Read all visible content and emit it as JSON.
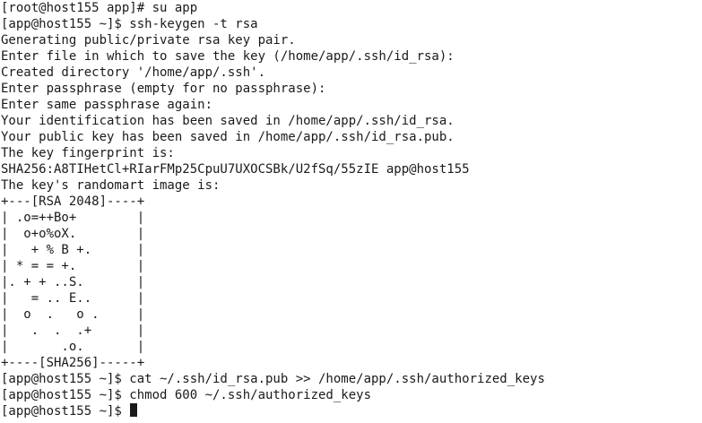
{
  "terminal": {
    "lines": [
      "[root@host155 app]# su app",
      "[app@host155 ~]$ ssh-keygen -t rsa",
      "Generating public/private rsa key pair.",
      "Enter file in which to save the key (/home/app/.ssh/id_rsa):",
      "Created directory '/home/app/.ssh'.",
      "Enter passphrase (empty for no passphrase):",
      "Enter same passphrase again:",
      "Your identification has been saved in /home/app/.ssh/id_rsa.",
      "Your public key has been saved in /home/app/.ssh/id_rsa.pub.",
      "The key fingerprint is:",
      "SHA256:A8TIHetCl+RIarFMp25CpuU7UXOCSBk/U2fSq/55zIE app@host155",
      "The key's randomart image is:",
      "+---[RSA 2048]----+",
      "| .o=++Bo+        |",
      "|  o+o%oX.        |",
      "|   + % B +.      |",
      "| * = = +.        |",
      "|. + + ..S.       |",
      "|   = .. E..      |",
      "|  o  .   o .     |",
      "|   .  .  .+      |",
      "|       .o.       |",
      "+----[SHA256]-----+",
      "[app@host155 ~]$ cat ~/.ssh/id_rsa.pub >> /home/app/.ssh/authorized_keys",
      "[app@host155 ~]$ chmod 600 ~/.ssh/authorized_keys"
    ],
    "prompt": "[app@host155 ~]$ "
  }
}
